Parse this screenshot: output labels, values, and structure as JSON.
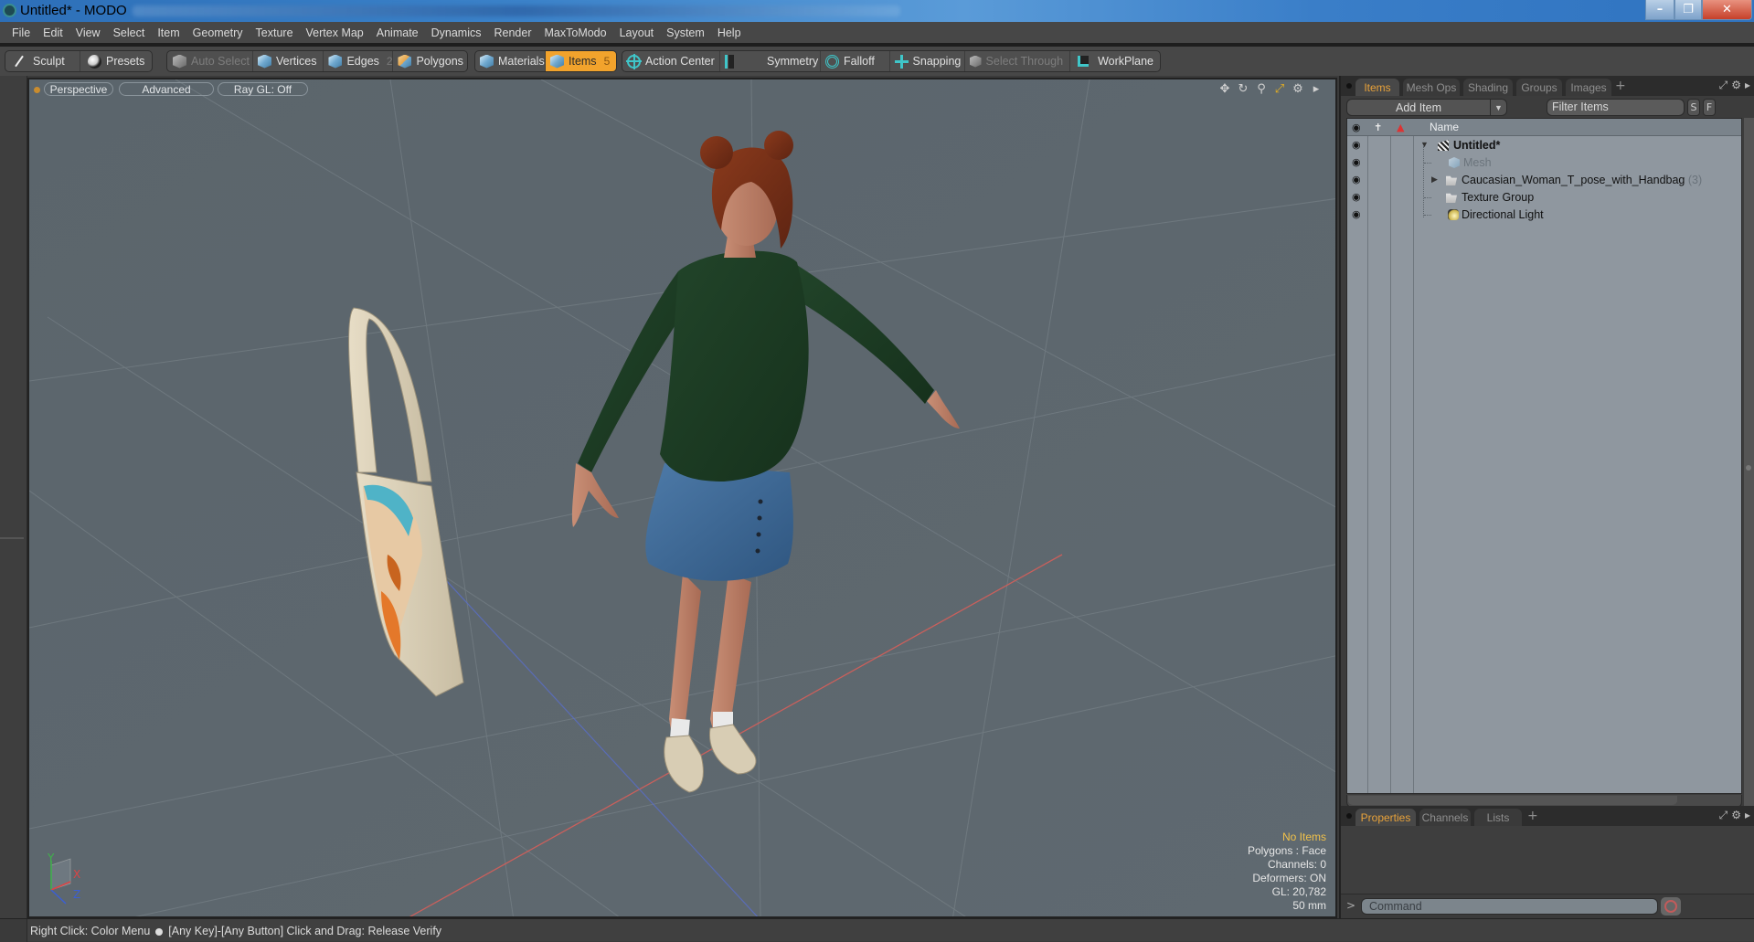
{
  "window": {
    "title": "Untitled* - MODO",
    "minimize_icon": "minimize-icon",
    "maximize_icon": "restore-icon",
    "close_icon": "close-icon"
  },
  "menubar": {
    "items": [
      "File",
      "Edit",
      "View",
      "Select",
      "Item",
      "Geometry",
      "Texture",
      "Vertex Map",
      "Animate",
      "Dynamics",
      "Render",
      "MaxToModo",
      "Layout",
      "System",
      "Help"
    ]
  },
  "toolbar": {
    "sculpt": "Sculpt",
    "presets": "Presets",
    "auto_select": "Auto Select",
    "vertices": "Vertices",
    "edges": "Edges",
    "edges_count": "2",
    "polygons": "Polygons",
    "materials": "Materials",
    "items": "Items",
    "items_count": "5",
    "action_center": "Action Center",
    "symmetry": "Symmetry",
    "falloff": "Falloff",
    "snapping": "Snapping",
    "select_through": "Select Through",
    "workplane": "WorkPlane",
    "active_mode": "Items",
    "accent_color": "#f2a32c"
  },
  "viewport": {
    "view": "Perspective",
    "shading": "Advanced",
    "raygl": "Ray GL: Off",
    "icons": [
      "move-view-icon",
      "rotate-view-icon",
      "zoom-view-icon",
      "maximize-view-icon",
      "gear-icon",
      "play-arrow-icon"
    ],
    "info": {
      "selection": "No Items",
      "polygons": "Polygons : Face",
      "channels": "Channels: 0",
      "deformers": "Deformers: ON",
      "gl": "GL: 20,782",
      "focal": "50 mm"
    },
    "axis": {
      "x": "X",
      "y": "Y",
      "z": "Z"
    },
    "scene_objects": [
      "woman-figure",
      "handbag"
    ]
  },
  "right_panel": {
    "top_tabs": [
      "Items",
      "Mesh Ops",
      "Shading",
      "Groups",
      "Images"
    ],
    "active_top_tab": "Items",
    "add_item": "Add Item",
    "filter_placeholder": "Filter Items",
    "s_button": "S",
    "f_button": "F",
    "tree_header": "Name",
    "tree": [
      {
        "label": "Untitled*",
        "type": "scene",
        "bold": true,
        "expanded": true,
        "count": ""
      },
      {
        "label": "Mesh",
        "type": "mesh",
        "dim": true,
        "count": ""
      },
      {
        "label": "Caucasian_Woman_T_pose_with_Handbag",
        "type": "group",
        "collapsed": true,
        "count": "(3)"
      },
      {
        "label": "Texture Group",
        "type": "group",
        "count": ""
      },
      {
        "label": "Directional Light",
        "type": "light",
        "count": ""
      }
    ],
    "bottom_tabs": [
      "Properties",
      "Channels",
      "Lists"
    ],
    "active_bottom_tab": "Properties",
    "command_prompt": ">",
    "command_placeholder": "Command"
  },
  "statusbar": {
    "left": "Right Click: Color Menu",
    "right": "[Any Key]-[Any Button] Click and Drag: Release Verify"
  }
}
